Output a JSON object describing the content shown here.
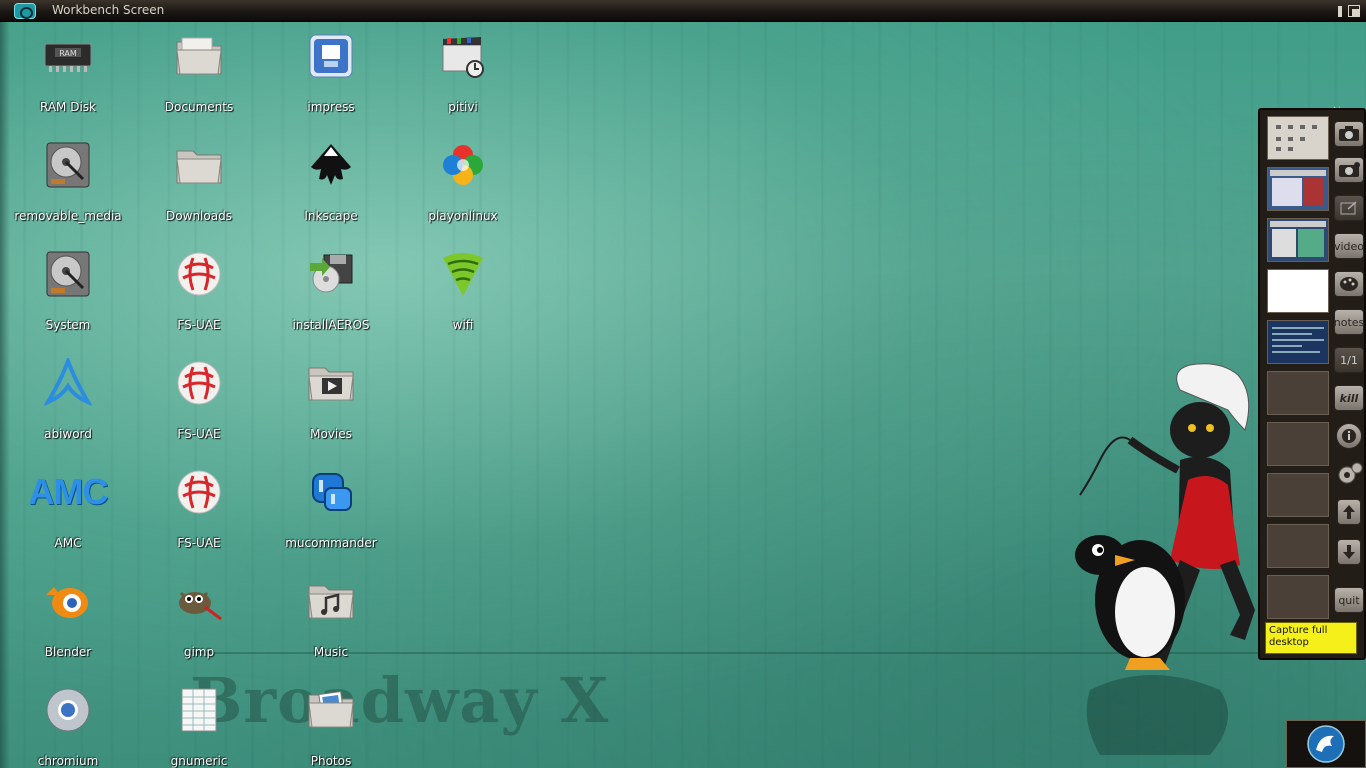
{
  "window": {
    "title": "Workbench Screen"
  },
  "desktop": {
    "icons": [
      {
        "label": "RAM Disk",
        "icon": "ram-disk-icon"
      },
      {
        "label": "Documents",
        "icon": "folder-icon"
      },
      {
        "label": "impress",
        "icon": "impress-icon"
      },
      {
        "label": "pitivi",
        "icon": "pitivi-icon"
      },
      {
        "label": "removable_media",
        "icon": "hard-drive-icon"
      },
      {
        "label": "Downloads",
        "icon": "folder-icon"
      },
      {
        "label": "Inkscape",
        "icon": "inkscape-icon"
      },
      {
        "label": "playonlinux",
        "icon": "playonlinux-icon"
      },
      {
        "label": "System",
        "icon": "hard-drive-icon"
      },
      {
        "label": "FS-UAE",
        "icon": "fs-uae-icon"
      },
      {
        "label": "installAEROS",
        "icon": "install-icon"
      },
      {
        "label": "wifi",
        "icon": "wifi-icon"
      },
      {
        "label": "abiword",
        "icon": "abiword-icon"
      },
      {
        "label": "FS-UAE",
        "icon": "fs-uae-icon"
      },
      {
        "label": "Movies",
        "icon": "movies-icon"
      },
      {
        "label": "AMC",
        "icon": "amc-icon"
      },
      {
        "label": "FS-UAE",
        "icon": "fs-uae-icon"
      },
      {
        "label": "mucommander",
        "icon": "mucommander-icon"
      },
      {
        "label": "Blender",
        "icon": "blender-icon"
      },
      {
        "label": "gimp",
        "icon": "gimp-icon"
      },
      {
        "label": "Music",
        "icon": "music-icon"
      },
      {
        "label": "chromium",
        "icon": "chromium-icon"
      },
      {
        "label": "gnumeric",
        "icon": "gnumeric-icon"
      },
      {
        "label": "Photos",
        "icon": "photos-icon"
      }
    ],
    "amc_logo_text": "AMC",
    "watermark": "Broadway X"
  },
  "panel": {
    "buttons": [
      "video",
      "notes",
      "1/1",
      "kill",
      "quit"
    ],
    "tooltip": "Capture full desktop"
  },
  "colors": {
    "desktop_bg": "#4aa08b",
    "panel_bg": "#231d17",
    "tooltip_bg": "#f5f01a"
  }
}
